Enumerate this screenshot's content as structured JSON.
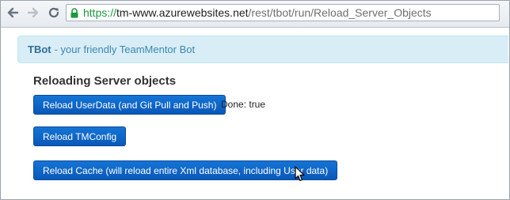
{
  "browser": {
    "url_scheme": "https://",
    "url_host": "tm-www.azurewebsites.net",
    "url_path": "/rest/tbot/run/Reload_Server_Objects",
    "secure_color": "#1a9a3a"
  },
  "banner": {
    "brand": "TBot",
    "tagline": "- your friendly TeamMentor Bot"
  },
  "main": {
    "title": "Reloading Server objects",
    "buttons": {
      "reload_userdata": "Reload UserData (and Git Pull and Push)",
      "reload_tmconfig": "Reload TMConfig",
      "reload_cache": "Reload Cache (will reload entire Xml database, including User data)"
    },
    "status": "Done: true"
  },
  "colors": {
    "button_primary": "#0a58b8",
    "alert_background": "#d9edf7",
    "alert_text": "#3a87ad"
  }
}
